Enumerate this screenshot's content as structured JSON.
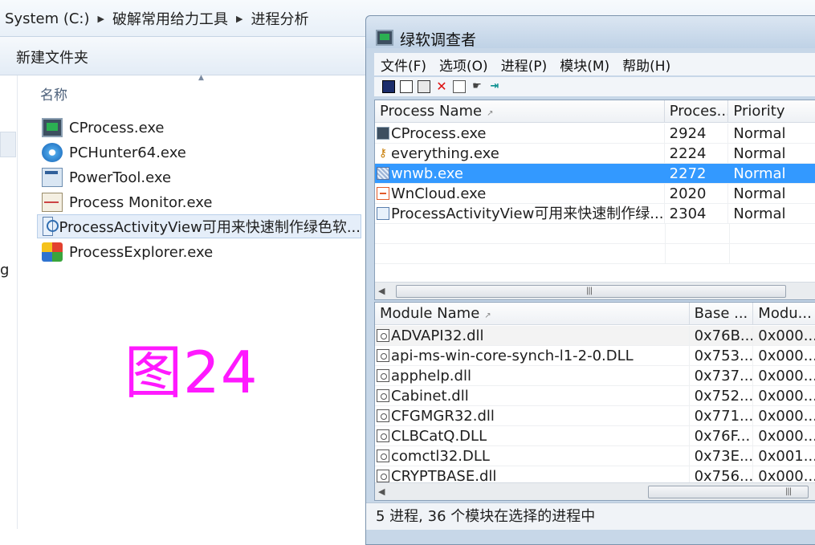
{
  "explorer": {
    "breadcrumb": [
      "System (C:)",
      "破解常用给力工具",
      "进程分析"
    ],
    "new_folder_label": "新建文件夹",
    "column_name": "名称",
    "nav_partial_text": "g",
    "files": [
      {
        "name": "CProcess.exe",
        "icon": "monitor-icon",
        "selected": false
      },
      {
        "name": "PCHunter64.exe",
        "icon": "pchunter-icon",
        "selected": false
      },
      {
        "name": "PowerTool.exe",
        "icon": "powertool-icon",
        "selected": false
      },
      {
        "name": "Process Monitor.exe",
        "icon": "process-monitor-icon",
        "selected": false
      },
      {
        "name": "ProcessActivityView可用来快速制作绿色软...",
        "icon": "magnifier-icon",
        "selected": true
      },
      {
        "name": "ProcessExplorer.exe",
        "icon": "process-explorer-icon",
        "selected": false
      }
    ],
    "figure_label": "图24",
    "figure_label_color": "#ff19ff"
  },
  "app": {
    "title": "绿软调查者",
    "menus": [
      "文件(F)",
      "选项(O)",
      "进程(P)",
      "模块(M)",
      "帮助(H)"
    ],
    "toolbar": [
      "save-icon",
      "copy-icon",
      "properties-icon",
      "delete-icon",
      "report-icon",
      "hand-icon",
      "exit-icon"
    ],
    "process_columns": [
      "Process Name",
      "Proces...",
      "Priority"
    ],
    "processes": [
      {
        "name": "CProcess.exe",
        "pid": "2924",
        "priority": "Normal",
        "icon": "monitor-icon",
        "selected": false
      },
      {
        "name": "everything.exe",
        "pid": "2224",
        "priority": "Normal",
        "icon": "key-icon",
        "selected": false
      },
      {
        "name": "wnwb.exe",
        "pid": "2272",
        "priority": "Normal",
        "icon": "wnwb-icon",
        "selected": true
      },
      {
        "name": "WnCloud.exe",
        "pid": "2020",
        "priority": "Normal",
        "icon": "cloud-icon",
        "selected": false
      },
      {
        "name": "ProcessActivityView可用来快速制作绿...",
        "pid": "2304",
        "priority": "Normal",
        "icon": "magnifier-icon",
        "selected": false
      }
    ],
    "module_columns": [
      "Module Name",
      "Base ...",
      "Modu..."
    ],
    "modules": [
      {
        "name": "ADVAPI32.dll",
        "base": "0x76B...",
        "size": "0x000..."
      },
      {
        "name": "api-ms-win-core-synch-l1-2-0.DLL",
        "base": "0x753...",
        "size": "0x000..."
      },
      {
        "name": "apphelp.dll",
        "base": "0x737...",
        "size": "0x000..."
      },
      {
        "name": "Cabinet.dll",
        "base": "0x752...",
        "size": "0x000..."
      },
      {
        "name": "CFGMGR32.dll",
        "base": "0x771...",
        "size": "0x000..."
      },
      {
        "name": "CLBCatQ.DLL",
        "base": "0x76F...",
        "size": "0x000..."
      },
      {
        "name": "comctl32.DLL",
        "base": "0x73E...",
        "size": "0x001..."
      },
      {
        "name": "CRYPTBASE.dll",
        "base": "0x756...",
        "size": "0x000..."
      }
    ],
    "status": "5 进程, 36 个模块在选择的进程中",
    "selection_color": "#3399ff"
  }
}
